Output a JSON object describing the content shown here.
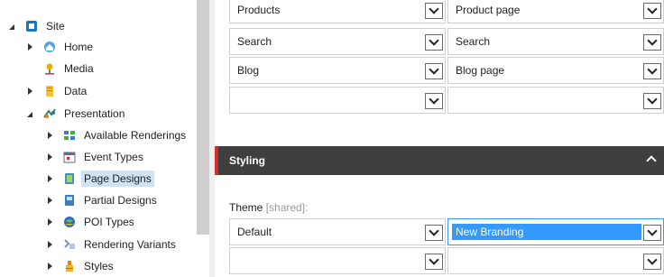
{
  "tree": {
    "root": {
      "label": "Site",
      "icon": "site-icon"
    },
    "items": [
      {
        "label": "Home",
        "icon": "home-icon",
        "state": "collapsed"
      },
      {
        "label": "Media",
        "icon": "media-icon",
        "state": "none"
      },
      {
        "label": "Data",
        "icon": "data-icon",
        "state": "collapsed"
      },
      {
        "label": "Presentation",
        "icon": "presentation-icon",
        "state": "expanded"
      },
      {
        "label": "Available Renderings",
        "icon": "renderings-icon",
        "state": "collapsed"
      },
      {
        "label": "Event Types",
        "icon": "event-types-icon",
        "state": "collapsed"
      },
      {
        "label": "Page Designs",
        "icon": "page-designs-icon",
        "state": "collapsed",
        "selected": true
      },
      {
        "label": "Partial Designs",
        "icon": "partial-designs-icon",
        "state": "collapsed"
      },
      {
        "label": "POI Types",
        "icon": "poi-types-icon",
        "state": "collapsed"
      },
      {
        "label": "Rendering Variants",
        "icon": "rendering-variants-icon",
        "state": "collapsed"
      },
      {
        "label": "Styles",
        "icon": "styles-icon",
        "state": "collapsed"
      }
    ]
  },
  "mapping_rows": [
    {
      "left": "Products",
      "right": "Product page"
    },
    {
      "left": "Search",
      "right": "Search"
    },
    {
      "left": "Blog",
      "right": "Blog page"
    },
    {
      "left": "",
      "right": ""
    }
  ],
  "styling": {
    "section_title": "Styling",
    "theme_label": "Theme",
    "theme_shared": "[shared]:",
    "rows": [
      {
        "left": "Default",
        "right": "New Branding",
        "right_highlighted": true
      },
      {
        "left": "",
        "right": ""
      }
    ]
  },
  "colors": {
    "section_bg": "#3f3f3f",
    "section_accent": "#d32f2f",
    "selection": "#3399ff",
    "tree_selected": "#cfe3f3"
  }
}
